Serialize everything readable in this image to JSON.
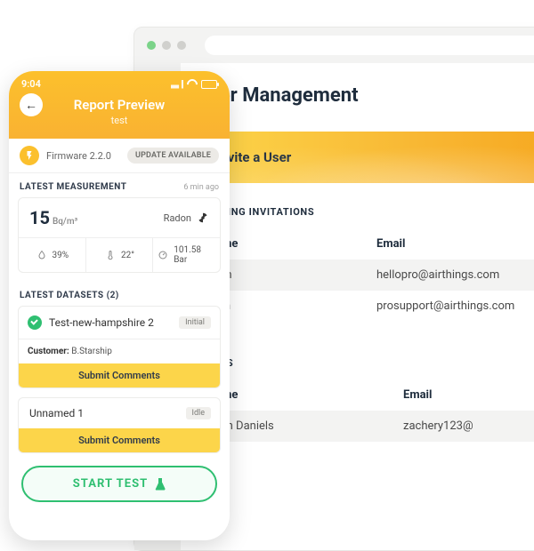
{
  "desktop": {
    "title": "User Management",
    "invite_label": "Invite a User",
    "pending": {
      "heading": "PENDING INVITATIONS",
      "col_name": "Name",
      "col_email": "Email",
      "rows": [
        {
          "name": "zach",
          "email": "hellopro@airthings.com"
        },
        {
          "name": "Glen",
          "email": "prosupport@airthings.com"
        }
      ]
    },
    "users": {
      "heading": "USERS",
      "col_name": "Name",
      "col_email": "Email",
      "rows": [
        {
          "name": "Zach Daniels",
          "email": "zachery123@"
        }
      ]
    }
  },
  "phone": {
    "status_time": "9:04",
    "nav_title": "Report Preview",
    "nav_subtitle": "test",
    "firmware_label": "Firmware 2.2.0",
    "update_badge": "UPDATE AVAILABLE",
    "latest_measurement_heading": "LATEST MEASUREMENT",
    "latest_measurement_time": "6 min ago",
    "measurement": {
      "value": "15",
      "unit": "Bq/m³",
      "type": "Radon",
      "humidity": "39%",
      "temperature": "22°",
      "pressure": "101.58 Bar"
    },
    "datasets_heading": "LATEST DATASETS (2)",
    "datasets": [
      {
        "title": "Test-new-hampshire 2",
        "tag": "Initial",
        "customer_label": "Customer:",
        "customer": "B.Starship",
        "submit": "Submit Comments",
        "has_check": true
      },
      {
        "title": "Unnamed 1",
        "tag": "Idle",
        "submit": "Submit Comments",
        "has_check": false
      }
    ],
    "start_button": "START TEST"
  }
}
